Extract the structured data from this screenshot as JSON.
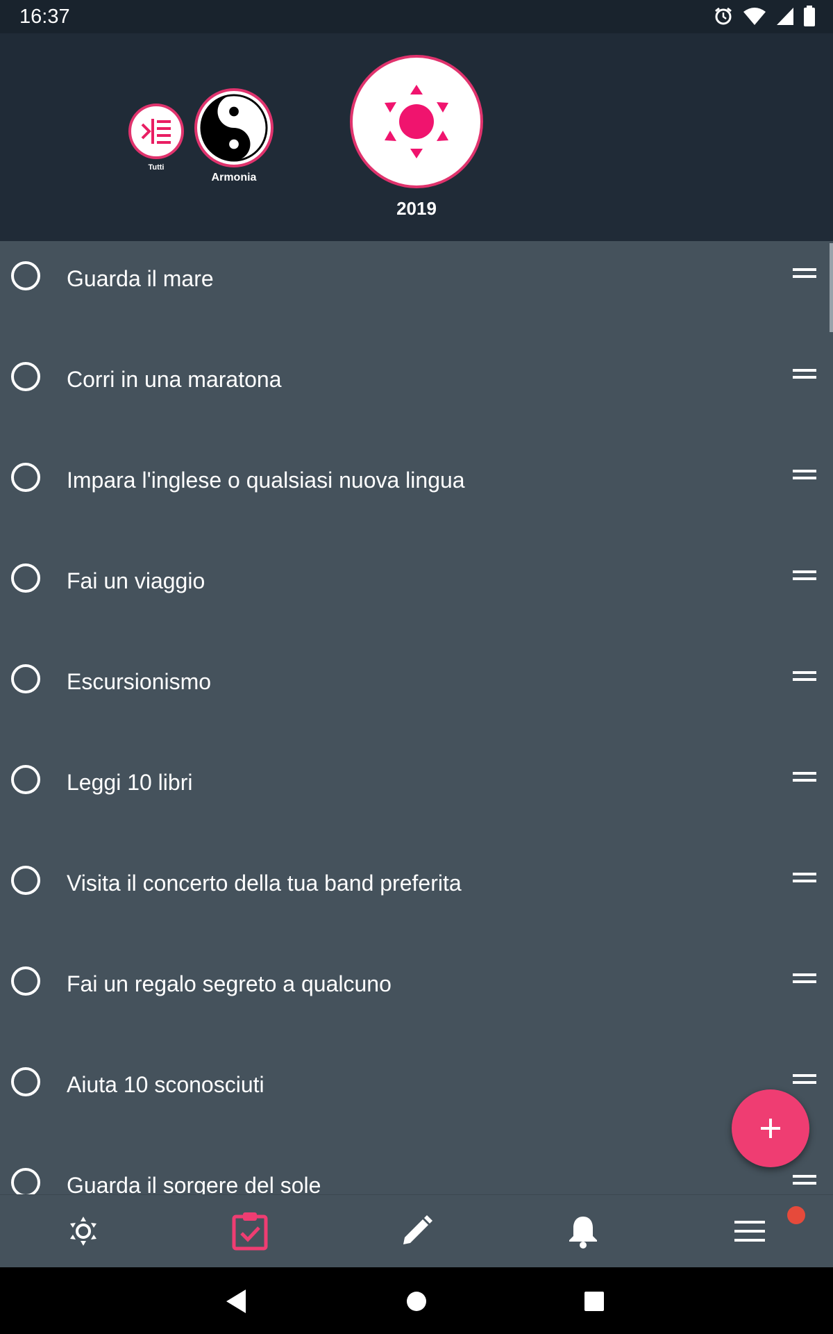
{
  "status_bar": {
    "time": "16:37",
    "icons": [
      "alarm-icon",
      "wifi-icon",
      "signal-icon",
      "battery-icon"
    ]
  },
  "header": {
    "categories": [
      {
        "label": "Tutti",
        "icon": "list-indent-icon"
      },
      {
        "label": "Armonia",
        "icon": "yin-yang-icon"
      },
      {
        "label": "2019",
        "icon": "sun-icon"
      }
    ]
  },
  "tasks": [
    {
      "title": "Guarda il mare"
    },
    {
      "title": "Corri in una maratona"
    },
    {
      "title": "Impara l'inglese o qualsiasi nuova lingua"
    },
    {
      "title": "Fai un viaggio"
    },
    {
      "title": "Escursionismo"
    },
    {
      "title": "Leggi 10 libri"
    },
    {
      "title": "Visita il concerto della tua band preferita"
    },
    {
      "title": "Fai un regalo segreto a qualcuno"
    },
    {
      "title": "Aiuta 10 sconosciuti"
    },
    {
      "title": "Guarda il sorgere del sole"
    }
  ],
  "fab": {
    "icon": "plus-icon"
  },
  "bottom_nav": {
    "items": [
      "sun-gear-icon",
      "clipboard-check-icon",
      "pencil-icon",
      "bell-icon",
      "menu-icon"
    ],
    "active": "clipboard-check-icon",
    "badge_color": "#e64a3b"
  },
  "colors": {
    "accent": "#ef3d72",
    "header_bg": "#202b37",
    "list_bg": "#45525c"
  }
}
